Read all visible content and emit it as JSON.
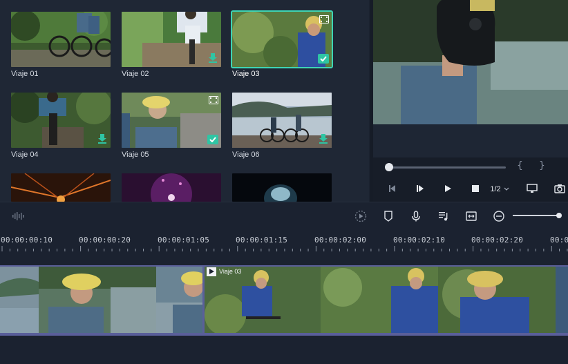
{
  "library": {
    "items": [
      {
        "label": "Viaje 01",
        "selected": false,
        "badge": null
      },
      {
        "label": "Viaje 02",
        "selected": false,
        "badge": "download"
      },
      {
        "label": "Viaje 03",
        "selected": true,
        "badge": "check",
        "type_icon": "film"
      },
      {
        "label": "Viaje 04",
        "selected": false,
        "badge": "download"
      },
      {
        "label": "Viaje 05",
        "selected": false,
        "badge": "check",
        "type_icon": "film"
      },
      {
        "label": "Viaje 06",
        "selected": false,
        "badge": "download"
      }
    ]
  },
  "preview": {
    "in_bracket": "{",
    "out_bracket": "}",
    "ratio": "1/2"
  },
  "ruler": {
    "timecodes": [
      "00:00:00:10",
      "00:00:00:20",
      "00:00:01:05",
      "00:00:01:15",
      "00:00:02:00",
      "00:00:02:10",
      "00:00:02:20",
      "00:00"
    ]
  },
  "timeline": {
    "clip_name": "Viaje 03"
  },
  "colors": {
    "accent": "#3ed5b5",
    "track": "#5a5f9a",
    "background": "#1b2230"
  }
}
